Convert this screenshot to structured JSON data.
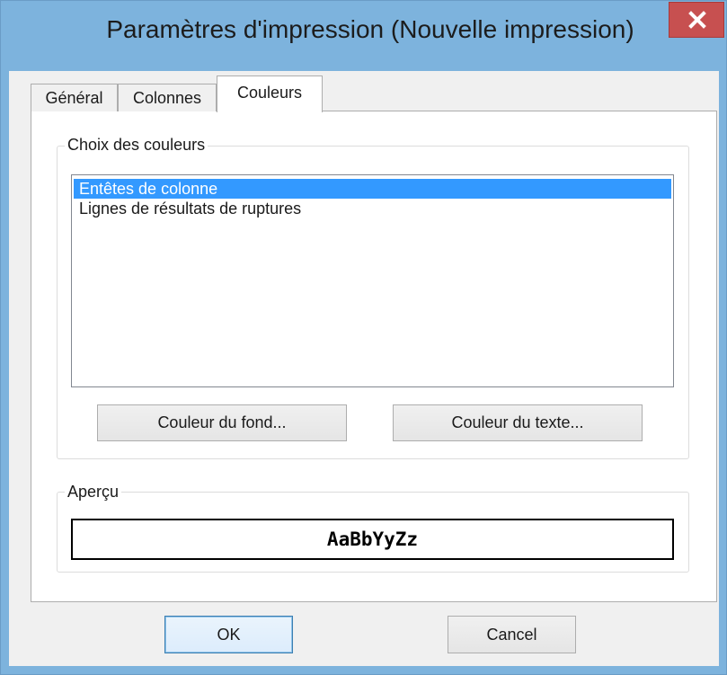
{
  "window": {
    "title": "Paramètres d'impression (Nouvelle impression)",
    "close_glyph": "✕"
  },
  "tabs": [
    {
      "label": "Général",
      "active": false
    },
    {
      "label": "Colonnes",
      "active": false
    },
    {
      "label": "Couleurs",
      "active": true
    }
  ],
  "colors_group": {
    "label": "Choix des couleurs",
    "items": [
      {
        "label": "Entêtes de colonne",
        "selected": true
      },
      {
        "label": "Lignes de résultats de ruptures",
        "selected": false
      }
    ],
    "background_button": "Couleur du fond...",
    "text_button": "Couleur du texte..."
  },
  "preview_group": {
    "label": "Aperçu",
    "sample_text": "AaBbYyZz"
  },
  "footer": {
    "ok_label": "OK",
    "cancel_label": "Cancel"
  },
  "theme": {
    "frame_color": "#7db3dd",
    "close_color": "#c75050",
    "selection_color": "#3399ff"
  }
}
